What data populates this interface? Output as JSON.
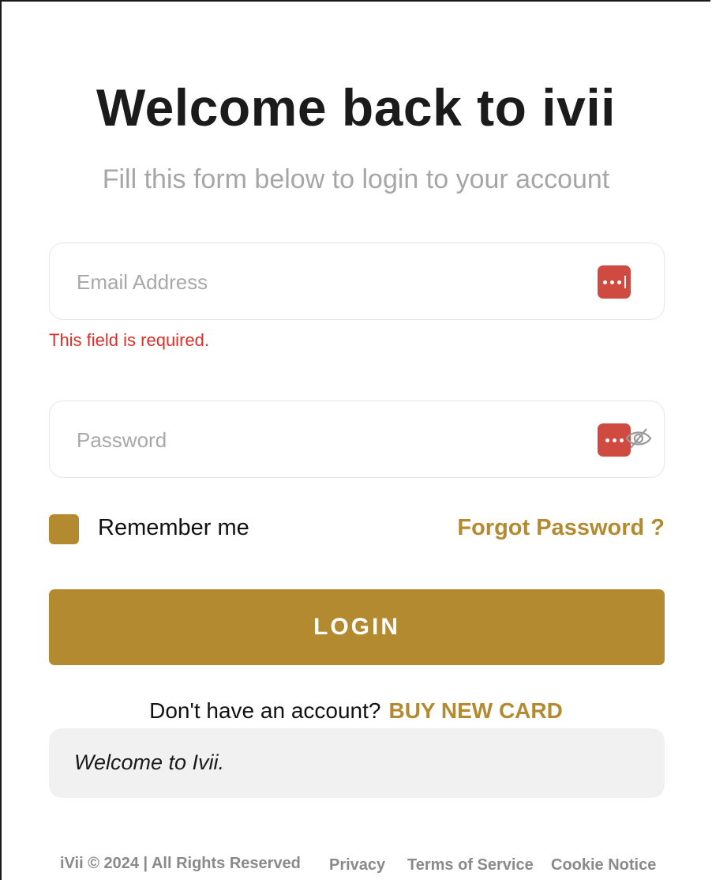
{
  "header": {
    "title": "Welcome back to ivii",
    "subtitle": "Fill this form below to login to your account"
  },
  "form": {
    "email_placeholder": "Email Address",
    "email_value": "",
    "email_error": "This field is required.",
    "password_placeholder": "Password",
    "password_value": "",
    "remember_label": "Remember me",
    "remember_checked": true,
    "forgot_label": "Forgot Password ?",
    "login_label": "LOGIN"
  },
  "signup": {
    "prompt": "Don't have an account?",
    "link_label": "BUY NEW CARD"
  },
  "notice": {
    "text": "Welcome to Ivii."
  },
  "footer": {
    "copyright": "iVii © 2024 | All Rights Reserved",
    "links": [
      "Privacy",
      "Terms of Service",
      "Cookie Notice"
    ]
  },
  "colors": {
    "accent": "#b38a30",
    "error": "#d9302b",
    "password_manager": "#cf4a41"
  },
  "icons": {
    "field_autofill": "password-manager-icon",
    "password_toggle": "eye-off-icon"
  }
}
